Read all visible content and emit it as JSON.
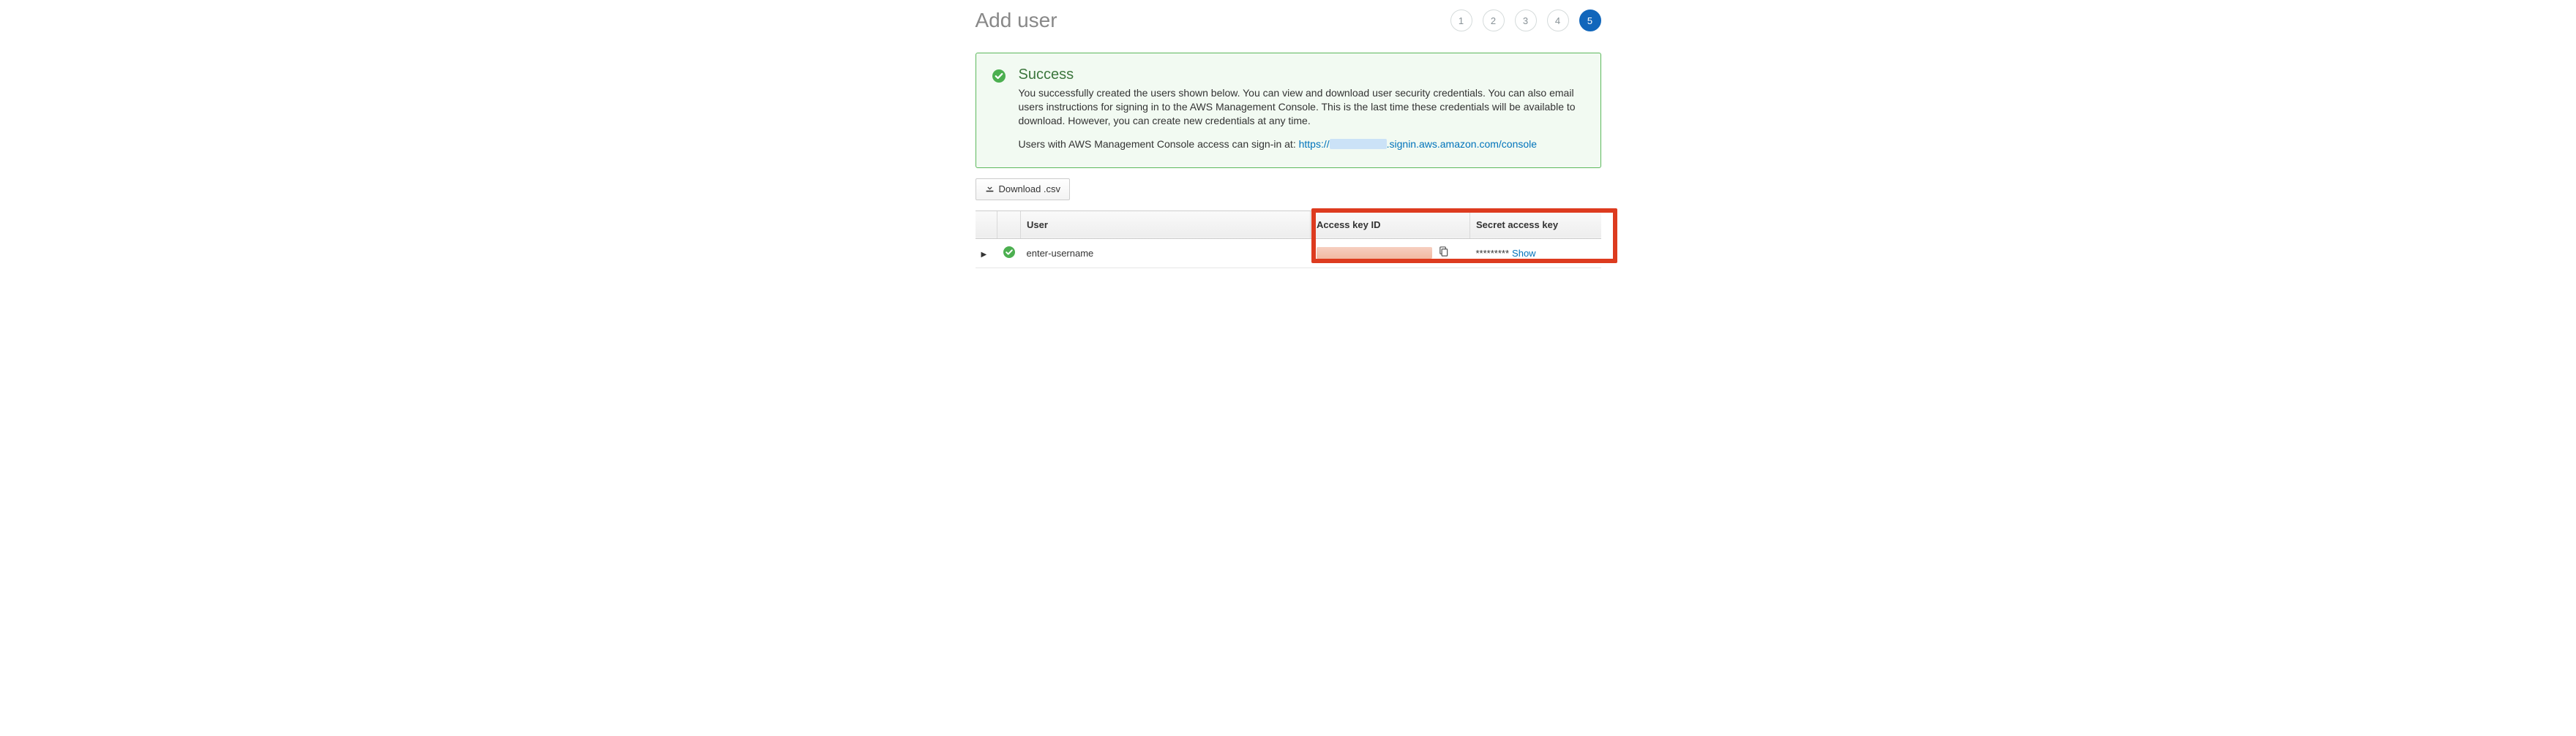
{
  "page": {
    "title": "Add user"
  },
  "steps": {
    "items": [
      "1",
      "2",
      "3",
      "4",
      "5"
    ],
    "active_index": 4
  },
  "success": {
    "title": "Success",
    "body": "You successfully created the users shown below. You can view and download user security credentials. You can also email users instructions for signing in to the AWS Management Console. This is the last time these credentials will be available to download. However, you can create new credentials at any time.",
    "signin_prefix": "Users with AWS Management Console access can sign-in at: ",
    "signin_url_prefix": "https://",
    "signin_url_suffix": ".signin.aws.amazon.com/console"
  },
  "actions": {
    "download_csv_label": "Download .csv"
  },
  "table": {
    "headers": {
      "user": "User",
      "access_key_id": "Access key ID",
      "secret_access_key": "Secret access key"
    },
    "rows": [
      {
        "username": "enter-username",
        "access_key_id_redacted": true,
        "secret_masked": "*********",
        "show_label": "Show"
      }
    ]
  }
}
